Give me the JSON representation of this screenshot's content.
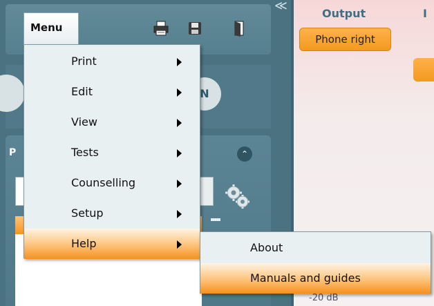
{
  "toolbar": {
    "menu_label": "Menu"
  },
  "menu": {
    "items": [
      {
        "label": "Print",
        "has_submenu": true
      },
      {
        "label": "Edit",
        "has_submenu": true
      },
      {
        "label": "View",
        "has_submenu": true
      },
      {
        "label": "Tests",
        "has_submenu": true
      },
      {
        "label": "Counselling",
        "has_submenu": true
      },
      {
        "label": "Setup",
        "has_submenu": true
      },
      {
        "label": "Help",
        "has_submenu": true,
        "active": true
      }
    ]
  },
  "help_submenu": {
    "items": [
      {
        "label": "About"
      },
      {
        "label": "Manuals and guides",
        "active": true
      }
    ]
  },
  "left_panel": {
    "panel_letter": "P",
    "circle_letter": "N",
    "collapse_glyph": "≪"
  },
  "right_panel": {
    "output_label": "Output",
    "second_label": "I",
    "output_button": "Phone right",
    "level_label": "-20 dB"
  },
  "colors": {
    "accent_orange": "#f7961f",
    "panel_teal": "#4a7281",
    "menu_bg": "#e8f0f2"
  }
}
